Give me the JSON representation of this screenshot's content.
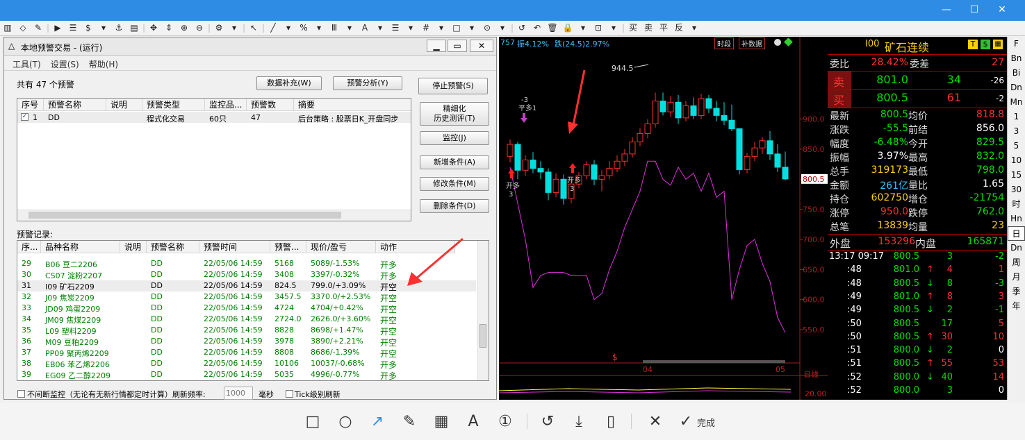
{
  "window": {
    "minimize": "—",
    "maximize": "☐",
    "close": "✕"
  },
  "toolbar_icons": [
    "▥",
    "◇",
    "✎",
    "|",
    "▶",
    "☰",
    "$",
    "▾",
    "⚓",
    "▤",
    "|",
    "✥",
    "⇕",
    "⊕",
    "⊖",
    "|",
    "⚙",
    "▾",
    "|",
    "↖",
    "|",
    "╱",
    "▾",
    "%",
    "▾",
    "Ⅲ",
    "▾",
    "A",
    "▾",
    "☰",
    "▾",
    "#",
    "▾",
    "□",
    "▾",
    "⊙",
    "▾",
    "|",
    "↺",
    "↶",
    "🗑",
    "🔒",
    "▾",
    "⊡",
    "▾",
    "|",
    "买",
    "卖",
    "平",
    "反",
    "▾"
  ],
  "dialog": {
    "title": "本地预警交易 - (运行)",
    "menu": [
      "工具(T)",
      "设置(S)",
      "帮助(H)"
    ],
    "count_text": "共有 47 个预警",
    "buttons": {
      "data_fill": "数据补充(W)",
      "alert_analysis": "预警分析(Y)",
      "stop_alert": "停止预警(S)",
      "refine": "精细化\n历史测评(T)",
      "monitor": "监控(J)",
      "add_cond": "新增条件(A)",
      "edit_cond": "修改条件(M)",
      "delete_cond": "删除条件(D)"
    },
    "top_table": {
      "headers": [
        "序号",
        "预警名称",
        "说明",
        "预警类型",
        "监控品...",
        "预警数",
        "摘要"
      ],
      "rows": [
        [
          "1",
          "DD",
          "",
          "程式化交易",
          "60只",
          "47",
          "后台策略 : 股票日K_开盘同步"
        ]
      ]
    },
    "records_label": "预警记录:",
    "rec_table": {
      "headers": [
        "序...",
        "品种名称",
        "说明",
        "预警名称",
        "预警时间",
        "预警...",
        "现价/盈亏",
        "动作"
      ],
      "rows": [
        [
          "29",
          "B06 豆二2206",
          "",
          "DD",
          "22/05/06 14:59",
          "5168",
          "5089/-1.53%",
          "开多"
        ],
        [
          "30",
          "CS07 淀粉2207",
          "",
          "DD",
          "22/05/06 14:59",
          "3408",
          "3397/-0.32%",
          "开多"
        ],
        [
          "31",
          "I09 矿石2209",
          "",
          "DD",
          "22/05/06 14:59",
          "824.5",
          "799.0/+3.09%",
          "开空"
        ],
        [
          "32",
          "J09 焦炭2209",
          "",
          "DD",
          "22/05/06 14:59",
          "3457.5",
          "3370.0/+2.53%",
          "开空"
        ],
        [
          "33",
          "JD09 鸡蛋2209",
          "",
          "DD",
          "22/05/06 14:59",
          "4724",
          "4704/+0.42%",
          "开空"
        ],
        [
          "34",
          "JM09 焦煤2209",
          "",
          "DD",
          "22/05/06 14:59",
          "2724.0",
          "2626.0/+3.60%",
          "开空"
        ],
        [
          "35",
          "L09 塑料2209",
          "",
          "DD",
          "22/05/06 14:59",
          "8828",
          "8698/+1.47%",
          "开空"
        ],
        [
          "36",
          "M09 豆粕2209",
          "",
          "DD",
          "22/05/06 14:59",
          "3978",
          "3890/+2.21%",
          "开空"
        ],
        [
          "37",
          "PP09 聚丙烯2209",
          "",
          "DD",
          "22/05/06 14:59",
          "8808",
          "8686/-1.39%",
          "开空"
        ],
        [
          "38",
          "EB06 苯乙烯2206",
          "",
          "DD",
          "22/05/06 14:59",
          "10106",
          "10037/-0.68%",
          "开多"
        ],
        [
          "39",
          "EG09 乙二醇2209",
          "",
          "DD",
          "22/05/06 14:59",
          "5035",
          "4996/-0.77%",
          "开多"
        ]
      ]
    },
    "footer": {
      "continuous": "不间断监控（无论有无新行情都定时计算）刷新频率:",
      "refresh_placeholder": "1000",
      "unit": "毫秒",
      "tick_refresh": "Tick级别刷新"
    }
  },
  "chart": {
    "header_prefix": "757",
    "amp_label": "振4.12%",
    "fall_label": "跌(24.5)2.97%",
    "btn_period": "时段",
    "btn_fill": "补数据",
    "peak_label": "944.5",
    "price_ticks": [
      "900.0",
      "850.0",
      "800.0",
      "750.0",
      "700.0",
      "650.0",
      "600.0",
      "550.0"
    ],
    "current_price": "800.5",
    "signals": [
      {
        "text": "开多",
        "sub": "3"
      },
      {
        "text": "平多1",
        "sub": "-3"
      },
      {
        "text": "开多",
        "sub": "3"
      }
    ],
    "axis_labels": [
      "04",
      "05"
    ],
    "period": "日线",
    "lower_tick": "20.00",
    "dollar_mark": "$",
    "candles": [
      [
        838,
        866,
        828,
        858
      ],
      [
        858,
        862,
        800,
        815
      ],
      [
        815,
        840,
        806,
        832
      ],
      [
        832,
        845,
        810,
        818
      ],
      [
        818,
        830,
        800,
        812
      ],
      [
        812,
        818,
        765,
        778
      ],
      [
        778,
        810,
        770,
        800
      ],
      [
        800,
        808,
        758,
        768
      ],
      [
        768,
        800,
        760,
        792
      ],
      [
        792,
        812,
        785,
        806
      ],
      [
        806,
        830,
        800,
        824
      ],
      [
        824,
        832,
        790,
        800
      ],
      [
        800,
        815,
        780,
        806
      ],
      [
        806,
        830,
        800,
        818
      ],
      [
        818,
        840,
        812,
        830
      ],
      [
        830,
        850,
        822,
        842
      ],
      [
        842,
        870,
        836,
        862
      ],
      [
        862,
        885,
        855,
        876
      ],
      [
        876,
        900,
        868,
        892
      ],
      [
        892,
        944,
        886,
        930
      ],
      [
        930,
        944,
        906,
        912
      ],
      [
        912,
        938,
        904,
        928
      ],
      [
        928,
        940,
        892,
        902
      ],
      [
        902,
        930,
        896,
        922
      ],
      [
        922,
        936,
        900,
        906
      ],
      [
        906,
        942,
        900,
        934
      ],
      [
        934,
        940,
        910,
        918
      ],
      [
        918,
        930,
        896,
        906
      ],
      [
        906,
        928,
        890,
        898
      ],
      [
        898,
        924,
        880,
        884
      ],
      [
        884,
        872,
        808,
        816
      ],
      [
        816,
        844,
        810,
        838
      ],
      [
        838,
        862,
        830,
        852
      ],
      [
        852,
        870,
        842,
        864
      ],
      [
        864,
        880,
        832,
        842
      ],
      [
        842,
        858,
        812,
        820
      ],
      [
        820,
        846,
        798,
        800.5
      ]
    ],
    "volume_line": [
      820,
      760,
      700,
      620,
      640,
      645,
      645,
      645,
      640,
      640,
      640,
      600,
      610,
      650,
      680,
      720,
      750,
      780,
      830,
      830,
      800,
      790,
      820,
      800,
      810,
      780,
      810,
      770,
      780,
      600,
      650,
      690,
      700,
      660,
      630,
      570,
      545
    ]
  },
  "quote": {
    "symbol": "I00",
    "name": "矿石连续",
    "badges": [
      "T",
      "$"
    ],
    "commit_ratio_label": "委比",
    "commit_ratio": "28.42%",
    "commit_diff_label": "委差",
    "commit_diff": "27",
    "sell_label": "卖",
    "sell_price": "801.0",
    "sell_vol": "34",
    "sell_chg": "-26",
    "buy_label": "买",
    "buy_price": "800.5",
    "buy_vol": "61",
    "buy_chg": "-2",
    "stats": [
      [
        "最新",
        "800.5",
        "均价",
        "818.8"
      ],
      [
        "涨跌",
        "-55.5",
        "前结",
        "856.0"
      ],
      [
        "幅度",
        "-6.48%",
        "今开",
        "829.5"
      ],
      [
        "振幅",
        "3.97%",
        "最高",
        "832.0"
      ],
      [
        "总手",
        "319173",
        "最低",
        "798.0"
      ],
      [
        "金额",
        "261亿",
        "量比",
        "1.65"
      ],
      [
        "持仓",
        "602750",
        "增仓",
        "-21754"
      ],
      [
        "涨停",
        "950.0",
        "跌停",
        "762.0"
      ],
      [
        "总笔",
        "13839",
        "均量",
        "23"
      ]
    ],
    "outer_label": "外盘",
    "outer": "153296",
    "inner_label": "内盘",
    "inner": "165871",
    "ticks": [
      [
        "13:17 09:17",
        "800.5",
        "",
        "3",
        "-2"
      ],
      [
        ":48",
        "801.0",
        "↑",
        "4",
        "1"
      ],
      [
        ":48",
        "800.5",
        "↓",
        "8",
        "-3"
      ],
      [
        ":49",
        "801.0",
        "↑",
        "8",
        "3"
      ],
      [
        ":49",
        "800.5",
        "↓",
        "2",
        "-1"
      ],
      [
        ":50",
        "800.5",
        "",
        "17",
        "5"
      ],
      [
        ":50",
        "800.5",
        "↑",
        "30",
        "10"
      ],
      [
        ":51",
        "800.0",
        "↓",
        "2",
        "0"
      ],
      [
        ":51",
        "800.5",
        "↑",
        "55",
        "53"
      ],
      [
        ":52",
        "800.0",
        "↓",
        "40",
        "14"
      ],
      [
        ":52",
        "800.0",
        "",
        "3",
        "0"
      ]
    ]
  },
  "vtabs": [
    "F",
    "Bn",
    "Bi",
    "Dn",
    "Mn",
    "1",
    "3",
    "5",
    "10",
    "15",
    "30",
    "时",
    "Hn",
    "日",
    "Dn",
    "周",
    "月",
    "季",
    "年"
  ],
  "bottom_tools": [
    "□",
    "○",
    "↗",
    "✎",
    "▦",
    "A",
    "①",
    "↺",
    "⤓",
    "▯",
    "✕",
    "✓"
  ],
  "bottom_done": "完成",
  "colors": {
    "titlebar": "#2f8ce5",
    "chart_bg": "#000000",
    "up": "#ff3030",
    "down": "#00e0e0",
    "record_text": "#008000"
  }
}
